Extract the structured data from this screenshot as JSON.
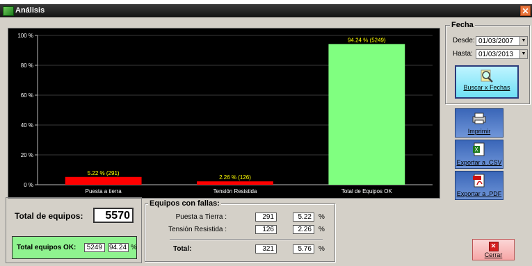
{
  "window": {
    "title": "Análisis",
    "close_glyph": "✕"
  },
  "chart_data": {
    "type": "bar",
    "categories": [
      "Puesta a tierra",
      "Tensión Resistida",
      "Total de Equipos OK"
    ],
    "values": [
      5.22,
      2.26,
      94.24
    ],
    "data_labels": [
      "5.22 % (291)",
      "2.26 % (126)",
      "94.24 % (5249)"
    ],
    "colors": [
      "#ff0000",
      "#ff0000",
      "#80ff80"
    ],
    "ylim": [
      0,
      100
    ],
    "yticks": [
      0,
      20,
      40,
      60,
      80,
      100
    ],
    "ytick_labels": [
      "0 %",
      "20 %",
      "40 %",
      "60 %",
      "80 %",
      "100 %"
    ],
    "grid": true,
    "title": "",
    "xlabel": "",
    "ylabel": ""
  },
  "fecha": {
    "legend": "Fecha",
    "desde_label": "Desde:",
    "desde_value": "01/03/2007",
    "hasta_label": "Hasta:",
    "hasta_value": "01/03/2013",
    "buscar_label": "Buscar x Fechas"
  },
  "actions": {
    "imprimir": "Imprimir",
    "exportar_csv": "Exportar a .CSV",
    "exportar_pdf": "Exportar a .PDF",
    "cerrar": "Cerrar"
  },
  "totals": {
    "total_label": "Total de equipos:",
    "total_value": "5570",
    "ok_label": "Total equipos OK:",
    "ok_count": "5249",
    "ok_pct": "94.24",
    "pct_sign": "%"
  },
  "fallas": {
    "legend": "Equipos con fallas:",
    "rows": [
      {
        "label": "Puesta a Tierra :",
        "count": "291",
        "pct": "5.22"
      },
      {
        "label": "Tensión Resistida :",
        "count": "126",
        "pct": "2.26"
      }
    ],
    "total_label": "Total:",
    "total_count": "321",
    "total_pct": "5.76",
    "pct_sign": "%"
  },
  "colors": {
    "chart_bg": "#000000",
    "bar_fail": "#ff0000",
    "bar_ok": "#80ff80",
    "label_yellow": "#ffff00"
  }
}
